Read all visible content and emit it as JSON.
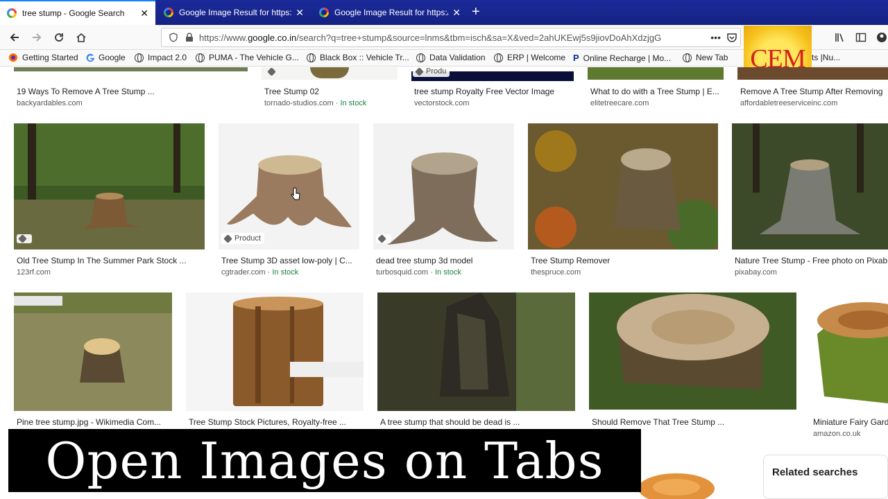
{
  "tabs": [
    {
      "label": "tree stump - Google Search",
      "active": true
    },
    {
      "label": "Google Image Result for https:/",
      "active": false
    },
    {
      "label": "Google Image Result for https:/",
      "active": false
    }
  ],
  "navbar": {
    "url_prefix": "https://www.",
    "url_domain": "google.co.in",
    "url_rest": "/search?q=tree+stump&source=lnms&tbm=isch&sa=X&ved=2ahUKEwj5s9jiovDoAhXdzjgG"
  },
  "bookmarks": [
    "Getting Started",
    "Google",
    "Impact 2.0",
    "PUMA - The Vehicle G...",
    "Black Box :: Vehicle Tr...",
    "Data Validation",
    "ERP | Welcome",
    "Online Recharge | Mo...",
    "New Tab",
    "ts |Nu..."
  ],
  "logo_text": "CEM",
  "results_top": [
    {
      "caption": "19 Ways To Remove A Tree Stump ...",
      "source": "backyardables.com",
      "stock": ""
    },
    {
      "caption": "Tree Stump 02",
      "source": "tornado-studios.com",
      "stock": "In stock"
    },
    {
      "caption": "tree stump Royalty Free Vector Image",
      "source": "vectorstock.com",
      "stock": ""
    },
    {
      "caption": "What to do with a Tree Stump | E...",
      "source": "elitetreecare.com",
      "stock": ""
    },
    {
      "caption": "Remove A Tree Stump After Removing",
      "source": "affordabletreeserviceinc.com",
      "stock": ""
    }
  ],
  "top_badge_product": "Produ",
  "results_mid": [
    {
      "caption": "Old Tree Stump In The Summer Park Stock ...",
      "source": "123rf.com",
      "stock": ""
    },
    {
      "caption": "Tree Stump 3D asset low-poly | C...",
      "source": "cgtrader.com",
      "stock": "In stock"
    },
    {
      "caption": "dead tree stump 3d model",
      "source": "turbosquid.com",
      "stock": "In stock"
    },
    {
      "caption": "Tree Stump Remover",
      "source": "thespruce.com",
      "stock": ""
    },
    {
      "caption": "Nature Tree Stump - Free photo on Pixab",
      "source": "pixabay.com",
      "stock": ""
    }
  ],
  "mid_badge_product": "Product",
  "results_bot": [
    {
      "caption": "Pine tree stump.jpg - Wikimedia Com...",
      "source": "",
      "stock": ""
    },
    {
      "caption": "Tree Stump Stock Pictures, Royalty-free ...",
      "source": "",
      "stock": ""
    },
    {
      "caption": "A tree stump that should be dead is ...",
      "source": "",
      "stock": ""
    },
    {
      "caption": "Should Remove That Tree Stump ...",
      "source": "",
      "stock": ""
    },
    {
      "caption": "Miniature Fairy Gard",
      "source": "amazon.co.uk",
      "stock": ""
    }
  ],
  "banner_text": "Open Images on Tabs",
  "related_title": "Related searches"
}
